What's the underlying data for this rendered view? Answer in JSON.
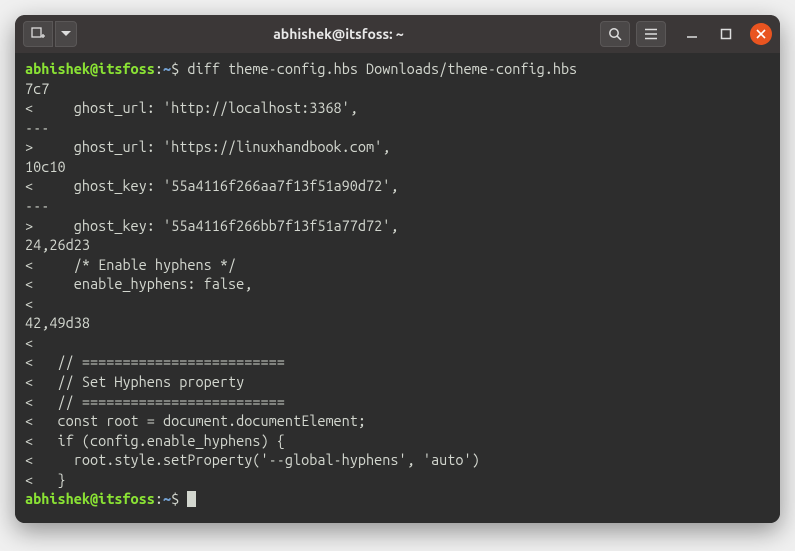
{
  "titlebar": {
    "title": "abhishek@itsfoss: ~"
  },
  "prompt": {
    "user_host": "abhishek@itsfoss",
    "colon": ":",
    "path": "~",
    "symbol": "$"
  },
  "lines": [
    {
      "type": "cmd",
      "text": "diff theme-config.hbs Downloads/theme-config.hbs"
    },
    {
      "type": "out",
      "text": "7c7"
    },
    {
      "type": "out",
      "text": "<     ghost_url: 'http://localhost:3368',"
    },
    {
      "type": "out",
      "text": "---"
    },
    {
      "type": "out",
      "text": ">     ghost_url: 'https://linuxhandbook.com',"
    },
    {
      "type": "out",
      "text": "10c10"
    },
    {
      "type": "out",
      "text": "<     ghost_key: '55a4116f266aa7f13f51a90d72',"
    },
    {
      "type": "out",
      "text": "---"
    },
    {
      "type": "out",
      "text": ">     ghost_key: '55a4116f266bb7f13f51a77d72',"
    },
    {
      "type": "out",
      "text": "24,26d23"
    },
    {
      "type": "out",
      "text": "<     /* Enable hyphens */"
    },
    {
      "type": "out",
      "text": "<     enable_hyphens: false,"
    },
    {
      "type": "out",
      "text": "<"
    },
    {
      "type": "out",
      "text": "42,49d38"
    },
    {
      "type": "out",
      "text": "<"
    },
    {
      "type": "out",
      "text": "<   // ========================="
    },
    {
      "type": "out",
      "text": "<   // Set Hyphens property"
    },
    {
      "type": "out",
      "text": "<   // ========================="
    },
    {
      "type": "out",
      "text": "<   const root = document.documentElement;"
    },
    {
      "type": "out",
      "text": "<   if (config.enable_hyphens) {"
    },
    {
      "type": "out",
      "text": "<     root.style.setProperty('--global-hyphens', 'auto')"
    },
    {
      "type": "out",
      "text": "<   }"
    },
    {
      "type": "prompt",
      "text": ""
    }
  ]
}
